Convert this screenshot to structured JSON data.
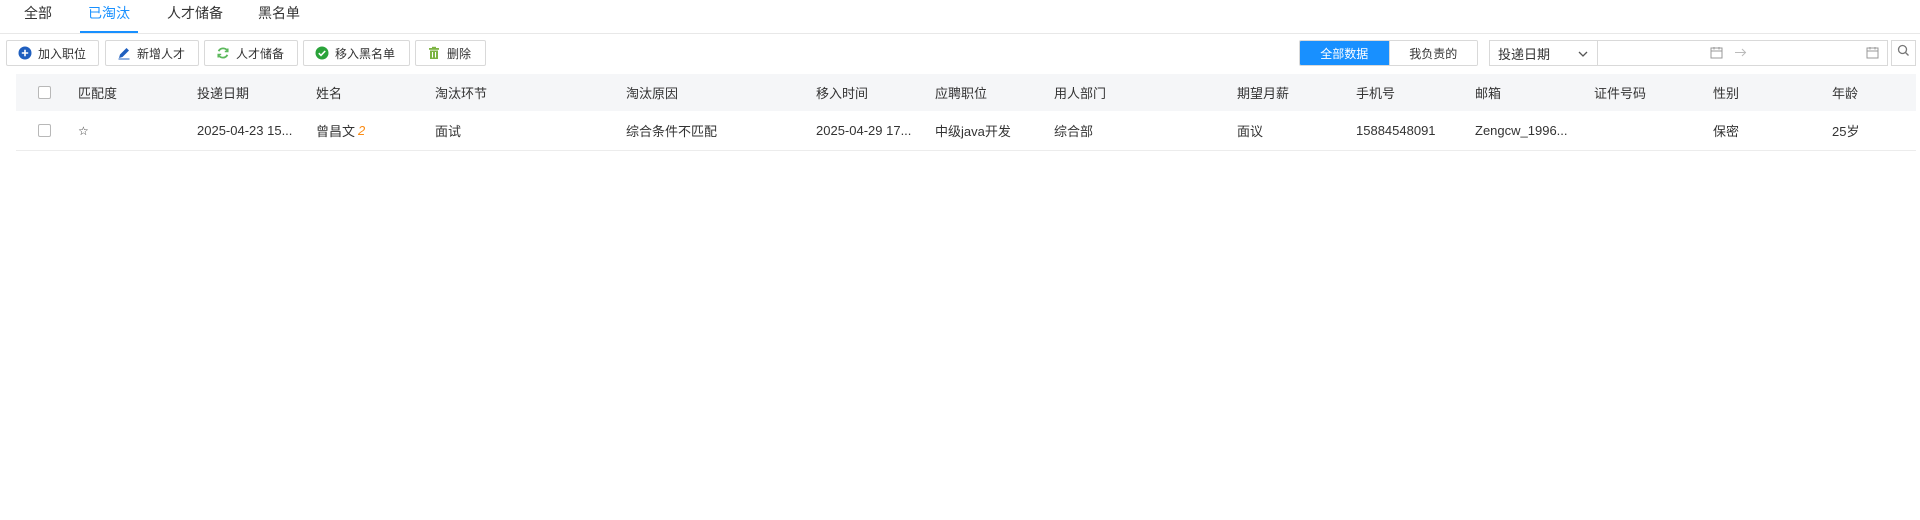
{
  "tabs": [
    "全部",
    "已淘汰",
    "人才储备",
    "黑名单"
  ],
  "toolbar": {
    "add_position": "加入职位",
    "new_talent": "新增人才",
    "talent_pool": "人才储备",
    "move_blacklist": "移入黑名单",
    "delete": "删除"
  },
  "scope": {
    "all": "全部数据",
    "mine": "我负责的"
  },
  "date_filter": {
    "selected": "投递日期"
  },
  "table": {
    "headers": [
      "匹配度",
      "投递日期",
      "姓名",
      "淘汰环节",
      "淘汰原因",
      "移入时间",
      "应聘职位",
      "用人部门",
      "期望月薪",
      "手机号",
      "邮箱",
      "证件号码",
      "性别",
      "年龄"
    ],
    "rows": [
      {
        "match": "☆",
        "apply_date": "2025-04-23 15...",
        "name": "曾昌文",
        "name_badge": "2",
        "stage": "面试",
        "reason": "综合条件不匹配",
        "moved_time": "2025-04-29 17...",
        "position": "中级java开发",
        "department": "综合部",
        "salary": "面议",
        "phone": "15884548091",
        "email": "Zengcw_1996...",
        "id_number": "",
        "gender": "保密",
        "age": "25岁"
      }
    ]
  },
  "colors": {
    "accent": "#1890ff",
    "badge": "#fa8c16",
    "header_bg": "#f5f6f8"
  }
}
